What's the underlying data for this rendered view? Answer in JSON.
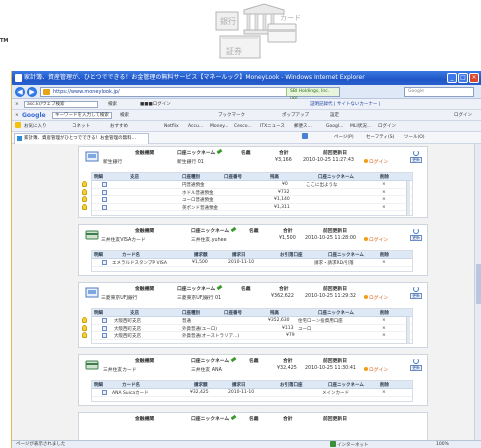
{
  "illustration": {
    "tm": "TM",
    "bank_label": "銀行",
    "card_label": "カード",
    "securities_label": "証券"
  },
  "window": {
    "title": "家計簿、資産管理が、ひとつでできる！お金管理の無料サービス【マネールック】MoneyLook - Windows Internet Explorer",
    "btn_min": "_",
    "btn_max": "□",
    "btn_close": "×"
  },
  "address": {
    "back": "◀",
    "forward": "▶",
    "url": "https://www.moneylook.jp/",
    "ssl": "SBI Holdings, Inc. [JP]",
    "search_placeholder": "Google"
  },
  "toolbars": {
    "tb1": {
      "search_value": "asc.kr/ウェブ検索",
      "items": [
        "検索",
        "■■■ログイン"
      ],
      "right": "証明記録代 | サイトないカーナー |"
    },
    "tb2": {
      "brand": "Google",
      "search_value": "キーワードを入力して検索",
      "items": [
        "検索",
        "ブックマーク",
        "ポップアップ",
        "設定",
        "ログイン"
      ]
    },
    "tb3": {
      "items": [
        "お気に入り",
        "コネット",
        "おすすめ",
        "Netflix",
        "Accu...",
        "Money...",
        "Cesco...",
        "ITXニュース",
        "郵便ス...",
        "Googl...",
        "MLI状況...",
        "ログイン"
      ]
    },
    "tab_title": "家計簿、資産管理がひとつでできる！お金管理の無料...",
    "right_tools": [
      "ページ(P)",
      "セーフティ(S)",
      "ツール(O)"
    ]
  },
  "status": {
    "left": "ページが表示されました",
    "zone": "インターネット",
    "zoom": "100%"
  },
  "labels": {
    "institution": "金融機関",
    "nickname": "口座ニックネーム",
    "holder": "名義",
    "total": "合計",
    "last_update": "前回更新日",
    "login": "ログイン",
    "update": "更新",
    "detail": "明細",
    "type": "支店",
    "account_type": "口座種別",
    "account_no": "口座番号",
    "balance": "残高",
    "sub_nickname": "口座ニックネーム",
    "delete": "削除",
    "card_name": "カード名",
    "billing_amount": "請求額",
    "billing_date": "請求日",
    "payment_account": "お引落口座",
    "nickname2": "口座ニックネーム"
  },
  "blocks": [
    {
      "institution": "新生銀行",
      "nickname": "新生銀行 01",
      "total": "¥3,166",
      "updated": "2010-10-25 11:27:43",
      "rows": [
        {
          "type": "円普通預金",
          "balance": "¥0",
          "nick": "ここに出ような"
        },
        {
          "type": "ホドル普通預金",
          "balance": "¥732",
          "nick": ""
        },
        {
          "type": "ユーロ普通預金",
          "balance": "¥1,140",
          "nick": ""
        },
        {
          "type": "英ポンド普通預金",
          "balance": "¥1,311",
          "nick": ""
        }
      ]
    },
    {
      "institution": "三井住友VISAカード",
      "nickname": "三井住友.yuhee",
      "total": "¥1,500",
      "updated": "2010-10-25 11:28:00",
      "rows": [
        {
          "card": "エメラルドスタンプP VISA",
          "amount": "¥1,500",
          "date": "2010-11-10",
          "nick": "請求・請求RD/引落"
        }
      ]
    },
    {
      "institution": "三菱東京UFJ銀行",
      "nickname": "三菱東京UFJ銀行 01",
      "total": "¥362,622",
      "updated": "2010-10-25 11:29:32",
      "rows": [
        {
          "branch": "大阪西町支店",
          "type": "普通",
          "balance": "¥352,630",
          "nick": "住宅ローン投資用口座"
        },
        {
          "branch": "大阪西町支店",
          "type": "外貨普通(ユーロ)",
          "balance": "¥113",
          "nick": "ユーロ"
        },
        {
          "branch": "大阪西町支店",
          "type": "外貨普通(オーストラリア...)",
          "balance": "¥79",
          "nick": ""
        }
      ]
    },
    {
      "institution": "三井住友カード",
      "nickname": "三井住友 ANA",
      "total": "¥32,425",
      "updated": "2010-10-25 11:30:41",
      "rows": [
        {
          "card": "ANA Suicaカード",
          "amount": "¥32,425",
          "date": "2010-11-10",
          "nick": "メインカード"
        }
      ]
    }
  ],
  "peek": {
    "institution": "金融機関",
    "nickname": "口座ニックネーム",
    "holder": "名義",
    "total": "合計",
    "last_update": "前回更新日"
  },
  "icons": [
    "bank-icon",
    "card-icon",
    "bulb-icon",
    "edit-icon",
    "pencil-icon",
    "refresh-icon",
    "login-icon"
  ]
}
